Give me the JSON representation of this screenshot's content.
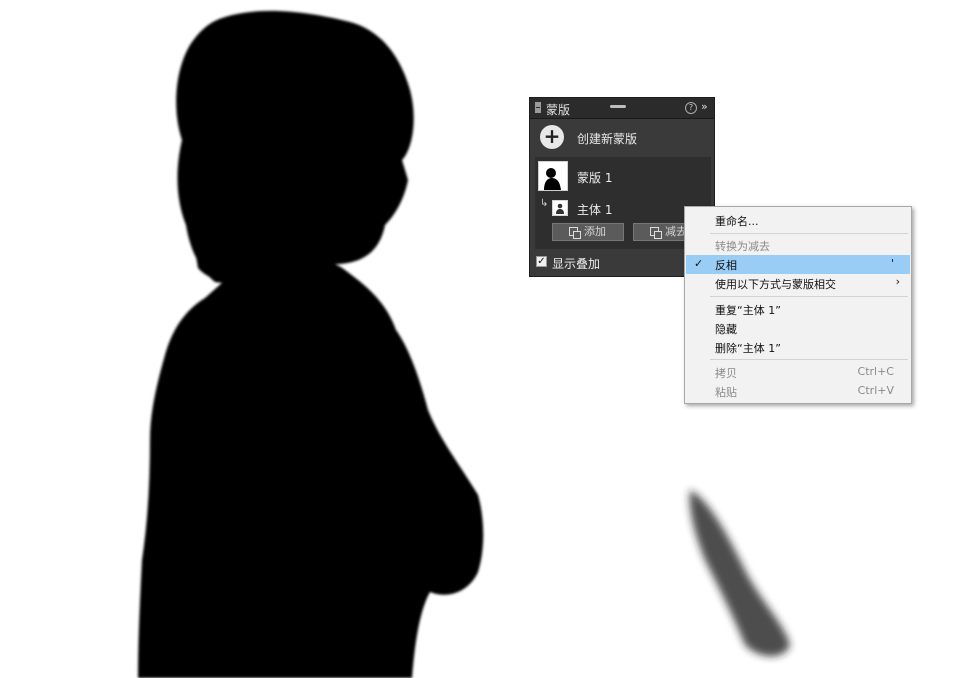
{
  "panel": {
    "title": "蒙版",
    "create_mask_label": "创建新蒙版",
    "mask_name": "蒙版 1",
    "submask_name": "主体 1",
    "add_button_label": "添加",
    "subtract_button_label": "减去",
    "show_overlay_label": "显示叠加",
    "show_overlay_checked": true,
    "icons": {
      "add": "plus-circle-icon",
      "help": "help-icon",
      "expand": "double-chevron-right-icon"
    }
  },
  "context_menu": {
    "items": [
      {
        "label": "重命名...",
        "disabled": false
      },
      {
        "label": "转换为减去",
        "disabled": true
      },
      {
        "label": "反相",
        "checked": true,
        "highlighted": true,
        "shortcut": "'"
      },
      {
        "label": "使用以下方式与蒙版相交",
        "submenu": true
      },
      {
        "label": "重复“主体 1”"
      },
      {
        "label": "隐藏"
      },
      {
        "label": "删除“主体 1”"
      },
      {
        "label": "拷贝",
        "shortcut": "Ctrl+C",
        "disabled": true
      },
      {
        "label": "粘贴",
        "shortcut": "Ctrl+V",
        "disabled": true
      }
    ],
    "highlight_color": "#99cdf5"
  },
  "colors": {
    "panel_bg": "#3a3a3a",
    "mask_black": "#000000",
    "canvas_white": "#ffffff"
  }
}
